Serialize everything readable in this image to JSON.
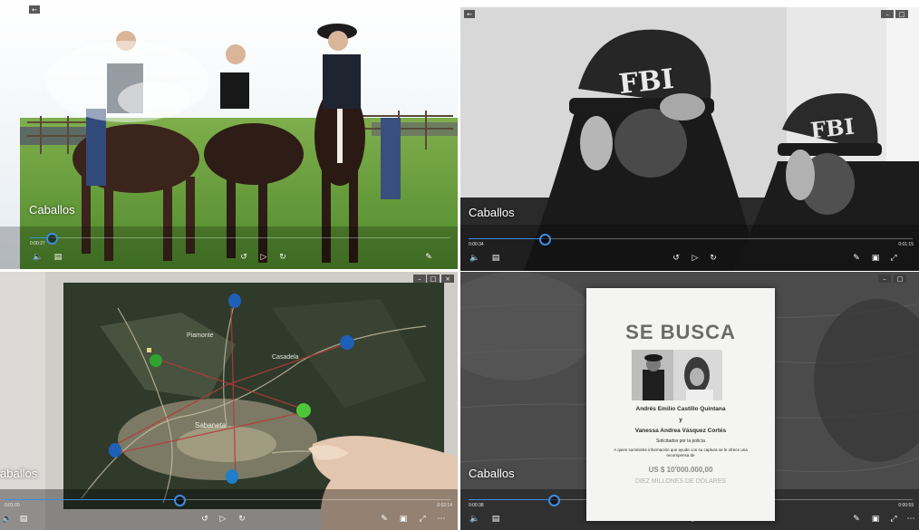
{
  "panels": [
    {
      "caption": "Caballos",
      "elapsed": "0:00:27",
      "progress": 0.05
    },
    {
      "caption": "Caballos",
      "elapsed": "0:00:34",
      "remaining": "0:01:15",
      "progress": 0.17
    },
    {
      "caption": "aballos",
      "elapsed": "0:01:00",
      "remaining": "0:02:14",
      "progress": 0.39
    },
    {
      "caption": "Caballos",
      "elapsed": "0:00:38",
      "remaining": "0:00:59",
      "progress": 0.19
    }
  ],
  "hats": {
    "left": "FBI",
    "right": "FBI"
  },
  "map_labels": {
    "north": "Piamonte",
    "east": "Casadela",
    "center": "Sabaneta"
  },
  "poster": {
    "title": "SE BUSCA",
    "name1": "Andrés Emilio Castillo Quintana",
    "conj": "y",
    "name2": "Vanessa Andrea Vásquez Cortés",
    "sought": "Solicitados por la policía",
    "info": "A quien suministre información que ayude con su captura se le ofrece una recompensa de",
    "reward": "US $ 10'000.000,00",
    "reward_words": "DIEZ MILLONES DE DÓLARES"
  },
  "icons": {
    "back": "back-arrow-icon",
    "volume": "volume-icon",
    "subtitles": "subtitles-icon",
    "rewind": "skip-back-10-icon",
    "play": "play-icon",
    "forward": "skip-forward-30-icon",
    "edit": "pen-icon",
    "miniview": "mini-view-icon",
    "fullscreen": "fullscreen-icon",
    "more": "more-icon"
  },
  "colors": {
    "accent": "#3d8de0"
  }
}
